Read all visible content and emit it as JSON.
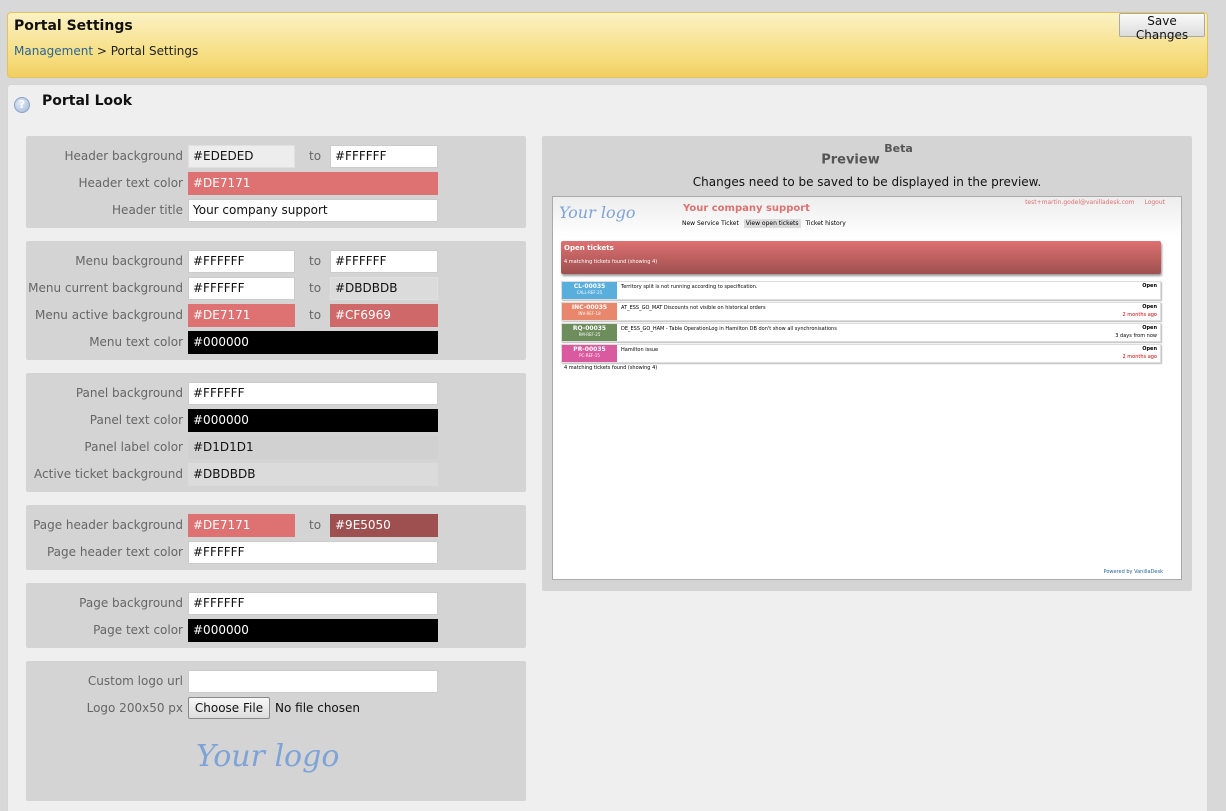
{
  "header": {
    "title": "Portal Settings",
    "breadcrumb_link": "Management",
    "breadcrumb_sep": " > ",
    "breadcrumb_current": "Portal Settings",
    "save_label": "Save Changes"
  },
  "section": {
    "title": "Portal Look",
    "help_icon": "?"
  },
  "groups": {
    "header": {
      "bg_label": "Header background",
      "bg_from": "#EDEDED",
      "bg_to": "#FFFFFF",
      "text_label": "Header text color",
      "text_value": "#DE7171",
      "title_label": "Header title",
      "title_value": "Your company support"
    },
    "menu": {
      "bg_label": "Menu background",
      "bg_from": "#FFFFFF",
      "bg_to": "#FFFFFF",
      "cur_label": "Menu current background",
      "cur_from": "#FFFFFF",
      "cur_to": "#DBDBDB",
      "active_label": "Menu active background",
      "active_from": "#DE7171",
      "active_to": "#CF6969",
      "text_label": "Menu text color",
      "text_value": "#000000"
    },
    "panel": {
      "bg_label": "Panel background",
      "bg_value": "#FFFFFF",
      "text_label": "Panel text color",
      "text_value": "#000000",
      "label_label": "Panel label color",
      "label_value": "#D1D1D1",
      "active_label": "Active ticket background",
      "active_value": "#DBDBDB"
    },
    "page_header": {
      "bg_label": "Page header background",
      "bg_from": "#DE7171",
      "bg_to": "#9E5050",
      "text_label": "Page header text color",
      "text_value": "#FFFFFF"
    },
    "page": {
      "bg_label": "Page background",
      "bg_value": "#FFFFFF",
      "text_label": "Page text color",
      "text_value": "#000000"
    },
    "logo": {
      "url_label": "Custom logo url",
      "url_value": "",
      "file_label": "Logo 200x50 px",
      "file_button": "Choose File",
      "file_status": "No file chosen",
      "sample": "Your logo"
    },
    "to_label": "to"
  },
  "preview": {
    "title": "Preview",
    "title_sup": "Beta",
    "note": "Changes need to be saved to be displayed in the preview.",
    "logo": "Your logo",
    "company": "Your company support",
    "user": "test+martin.godel@vanilladesk.com",
    "logout": "Logout",
    "menu": [
      "New Service Ticket",
      "View open tickets",
      "Ticket history"
    ],
    "panel_title": "Open tickets",
    "panel_count": "4 matching tickets found (showing 4)",
    "tickets": [
      {
        "id": "CL-00035",
        "ref": "CALL-REF-25",
        "subject": "Territory split is not running according to specification.",
        "status": "Open",
        "when": "",
        "color": "#5aaedb"
      },
      {
        "id": "INC-00035",
        "ref": "INV-REF-18",
        "subject": "AT_ESS_GO_MAT Discounts not visible on historical orders",
        "status": "Open",
        "when": "2 months ago",
        "color": "#e9876d"
      },
      {
        "id": "RQ-00035",
        "ref": "RM-REF-25",
        "subject": "DE_ESS_GO_HAM - Table OperationLog in Hamilton DB don't show all synchronisations",
        "status": "Open",
        "when": "3 days from now",
        "color": "#6d8d5d"
      },
      {
        "id": "PR-00035",
        "ref": "PC-REF-15",
        "subject": "Hamilton issue",
        "status": "Open",
        "when": "2 months ago",
        "color": "#d95a9e"
      }
    ],
    "footer_count": "4 matching tickets found (showing 4)",
    "powered": "Powered by VanillaDesk"
  }
}
